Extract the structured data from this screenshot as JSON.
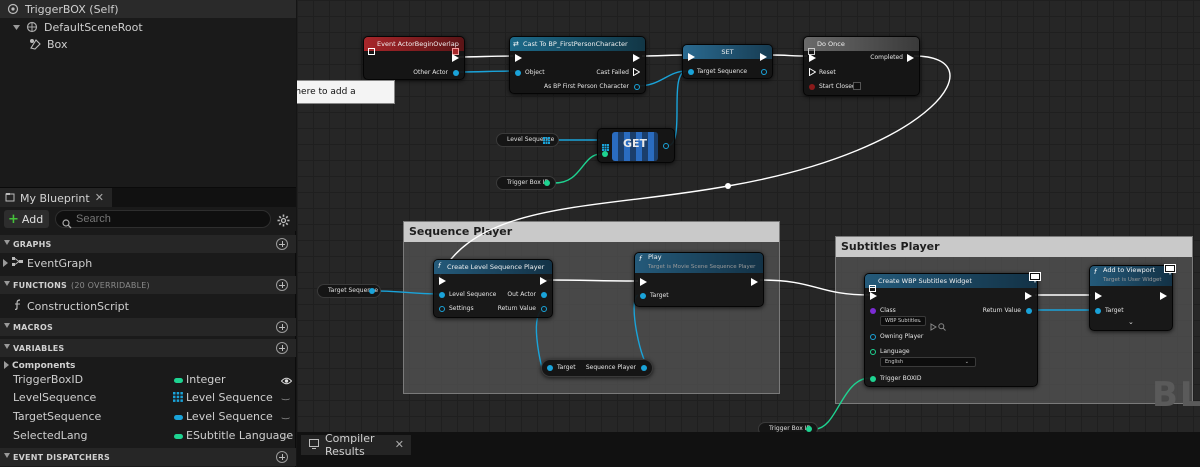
{
  "components": {
    "self": "TriggerBOX (Self)",
    "root": "DefaultSceneRoot",
    "box": "Box"
  },
  "tooltip": "Drop asset here to add a component.",
  "my_blueprint": {
    "tab_label": "My Blueprint",
    "add_label": "Add",
    "search_placeholder": "Search"
  },
  "sections": {
    "graphs": "GRAPHS",
    "event_graph": "EventGraph",
    "functions": "FUNCTIONS",
    "functions_sub": "(20 OVERRIDABLE)",
    "construction_script": "ConstructionScript",
    "macros": "MACROS",
    "variables": "VARIABLES",
    "components_sub": "Components",
    "event_dispatchers": "EVENT DISPATCHERS"
  },
  "variables": [
    {
      "name": "TriggerBoxID",
      "type": "Integer",
      "color": "#1ed391"
    },
    {
      "name": "LevelSequence",
      "type": "Level Sequence",
      "color": "#1aa3d9"
    },
    {
      "name": "TargetSequence",
      "type": "Level Sequence",
      "color": "#1aa3d9"
    },
    {
      "name": "SelectedLang",
      "type": "ESubtitle Language",
      "color": "#1ed391"
    }
  ],
  "nodes": {
    "event_overlap": {
      "title": "Event ActorBeginOverlap",
      "other_actor": "Other Actor"
    },
    "cast": {
      "title": "Cast To BP_FirstPersonCharacter",
      "object": "Object",
      "cast_failed": "Cast Failed",
      "as_bp": "As BP First Person Character"
    },
    "set": {
      "title": "SET",
      "target_sequence": "Target Sequence"
    },
    "do_once": {
      "title": "Do Once",
      "completed": "Completed",
      "reset": "Reset",
      "start_closed": "Start Closed"
    },
    "level_sequence_var": "Level Sequence",
    "get": "GET",
    "trigger_box_id_var": "Trigger Box ID",
    "target_sequence_var": "Target Sequence",
    "create_player": {
      "title": "Create Level Sequence Player",
      "level_sequence": "Level Sequence",
      "settings": "Settings",
      "out_actor": "Out Actor",
      "return_value": "Return Value"
    },
    "play": {
      "title": "Play",
      "subtitle": "Target is Movie Scene Sequence Player",
      "target": "Target"
    },
    "sequence_player_var": {
      "target": "Target",
      "sequence_player": "Sequence Player"
    },
    "create_widget": {
      "title": "Create WBP Subtitles Widget",
      "class": "Class",
      "class_value": "WBP Subtitles",
      "return_value": "Return Value",
      "owning_player": "Owning Player",
      "language": "Language",
      "language_value": "English",
      "trigger_boxid": "Trigger BOXID"
    },
    "add_viewport": {
      "title": "Add to Viewport",
      "subtitle": "Target is User Widget",
      "target": "Target"
    },
    "trigger_box_id_var2": "Trigger Box ID"
  },
  "comments": {
    "sequence_player": "Sequence Player",
    "subtitles_player": "Subtitles Player"
  },
  "watermark": "BL",
  "bottom": {
    "compiler_results": "Compiler Results"
  },
  "colors": {
    "object_pin": "#1aa3d9",
    "integer_pin": "#1ed391",
    "event_header": "#a8262a",
    "function_header": "#245a7a",
    "macro_header": "#5d5d5d"
  }
}
